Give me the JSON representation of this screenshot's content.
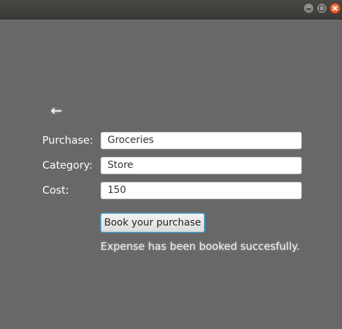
{
  "window": {
    "controls": {
      "minimize": "minimize-icon",
      "maximize": "maximize-icon",
      "close": "close-icon"
    }
  },
  "nav": {
    "back_icon": "←"
  },
  "form": {
    "purchase_label": "Purchase:",
    "purchase_value": "Groceries",
    "category_label": "Category:",
    "category_value": "Store",
    "cost_label": "Cost:",
    "cost_value": "150",
    "submit_label": "Book your purchase"
  },
  "status": {
    "message": "Expense has been booked succesfully."
  },
  "colors": {
    "background": "#686868",
    "titlebar": "#3b3a36",
    "close_button": "#e2582a",
    "focus_border": "#3aa6d6"
  }
}
